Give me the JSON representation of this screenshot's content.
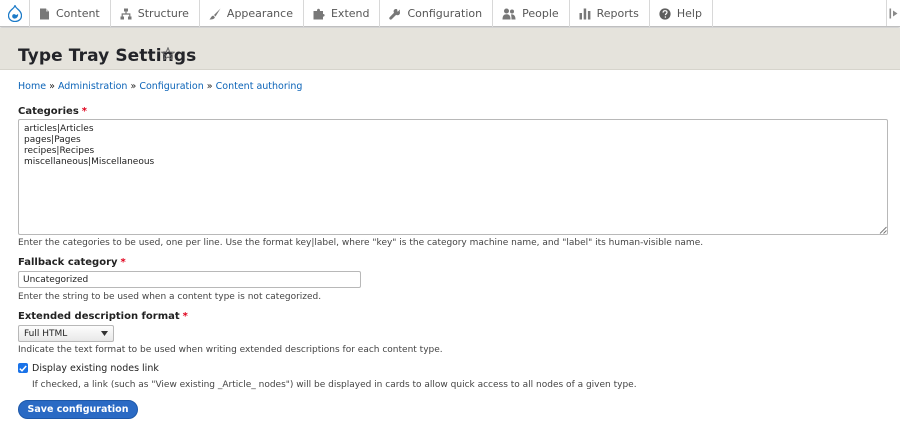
{
  "toolbar": {
    "logo_icon": "drupal-drop-icon",
    "items": [
      {
        "label": "Content",
        "icon": "page-icon"
      },
      {
        "label": "Structure",
        "icon": "structure-icon"
      },
      {
        "label": "Appearance",
        "icon": "paintbrush-icon"
      },
      {
        "label": "Extend",
        "icon": "puzzle-icon"
      },
      {
        "label": "Configuration",
        "icon": "wrench-icon"
      },
      {
        "label": "People",
        "icon": "people-icon"
      },
      {
        "label": "Reports",
        "icon": "bar-chart-icon"
      },
      {
        "label": "Help",
        "icon": "help-icon"
      }
    ]
  },
  "page": {
    "title": "Type Tray Settings"
  },
  "breadcrumb": {
    "items": [
      "Home",
      "Administration",
      "Configuration",
      "Content authoring"
    ],
    "separator": "»"
  },
  "form": {
    "categories": {
      "label": "Categories",
      "required_mark": "*",
      "value": "articles|Articles\npages|Pages\nrecipes|Recipes\nmiscellaneous|Miscellaneous",
      "description": "Enter the categories to be used, one per line. Use the format key|label, where \"key\" is the category machine name, and \"label\" its human-visible name."
    },
    "fallback": {
      "label": "Fallback category",
      "required_mark": "*",
      "value": "Uncategorized",
      "description": "Enter the string to be used when a content type is not categorized."
    },
    "format": {
      "label": "Extended description format",
      "required_mark": "*",
      "selected": "Full HTML",
      "description": "Indicate the text format to be used when writing extended descriptions for each content type."
    },
    "existing_nodes": {
      "label": "Display existing nodes link",
      "checked": true,
      "description": "If checked, a link (such as \"View existing _Article_ nodes\") will be displayed in cards to allow quick access to all nodes of a given type."
    },
    "submit_label": "Save configuration"
  },
  "colors": {
    "link": "#0c64b8",
    "required": "#e0001b",
    "primary_button": "#2a6ac4",
    "header_bg": "#e5e3dc"
  }
}
